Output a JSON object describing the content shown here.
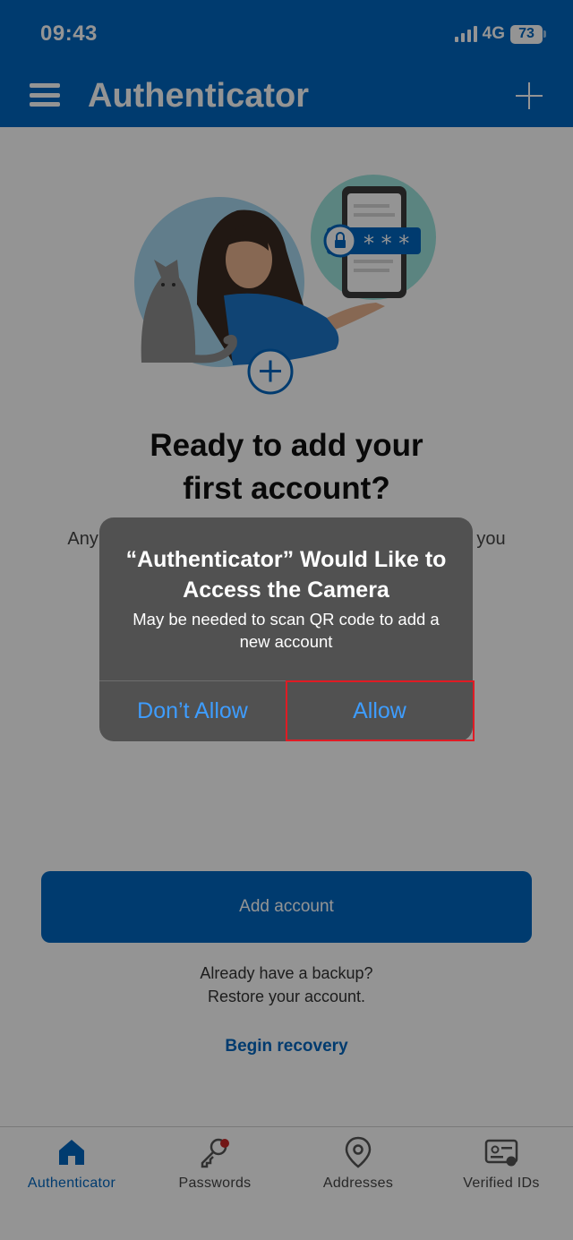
{
  "status_bar": {
    "time": "09:43",
    "network": "4G",
    "battery": "73"
  },
  "app_bar": {
    "title": "Authenticator"
  },
  "main": {
    "headline_line1": "Ready to add your",
    "headline_line2": "first account?",
    "subtext": "Any Microsoft account or other type of account that you"
  },
  "add_account_label": "Add account",
  "backup": {
    "line1": "Already have a backup?",
    "line2": "Restore your account."
  },
  "begin_recovery_label": "Begin recovery",
  "tabs": [
    {
      "label": "Authenticator",
      "icon": "home-icon",
      "active": true
    },
    {
      "label": "Passwords",
      "icon": "key-icon",
      "active": false
    },
    {
      "label": "Addresses",
      "icon": "location-pin-icon",
      "active": false
    },
    {
      "label": "Verified IDs",
      "icon": "id-card-icon",
      "active": false
    }
  ],
  "dialog": {
    "title": "“Authenticator” Would Like to Access the Camera",
    "message": "May be needed to scan QR code to add a new account",
    "deny_label": "Don’t Allow",
    "allow_label": "Allow"
  },
  "colors": {
    "brand": "#0067c0",
    "alert_bg": "#515151",
    "alert_button": "#3e9dff",
    "highlight": "#e01b24"
  }
}
